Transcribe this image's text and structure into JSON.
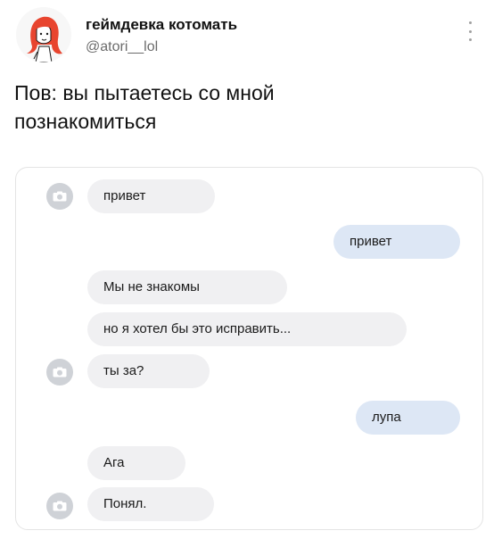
{
  "tweet": {
    "display_name": "геймдевка котомать",
    "handle": "@atori__lol",
    "text": "Пов: вы пытаетесь со мной познакомиться"
  },
  "chat": {
    "messages": [
      {
        "text": "привет",
        "side": "in",
        "camera_icon": true
      },
      {
        "text": "привет",
        "side": "out",
        "camera_icon": false
      },
      {
        "text": "Мы не знакомы",
        "side": "in",
        "camera_icon": false
      },
      {
        "text": "но я хотел бы это исправить...",
        "side": "in",
        "camera_icon": false
      },
      {
        "text": "ты за?",
        "side": "in",
        "camera_icon": true
      },
      {
        "text": "лупа",
        "side": "out",
        "camera_icon": false
      },
      {
        "text": "Ага",
        "side": "in",
        "camera_icon": false
      },
      {
        "text": "Понял.",
        "side": "in",
        "camera_icon": true
      }
    ]
  },
  "colors": {
    "incoming_bubble": "#f0f0f2",
    "outgoing_bubble": "#dde7f5",
    "avatar_hair": "#e8452f"
  },
  "icons": {
    "more": "more-vertical-icon",
    "camera": "camera-icon"
  }
}
